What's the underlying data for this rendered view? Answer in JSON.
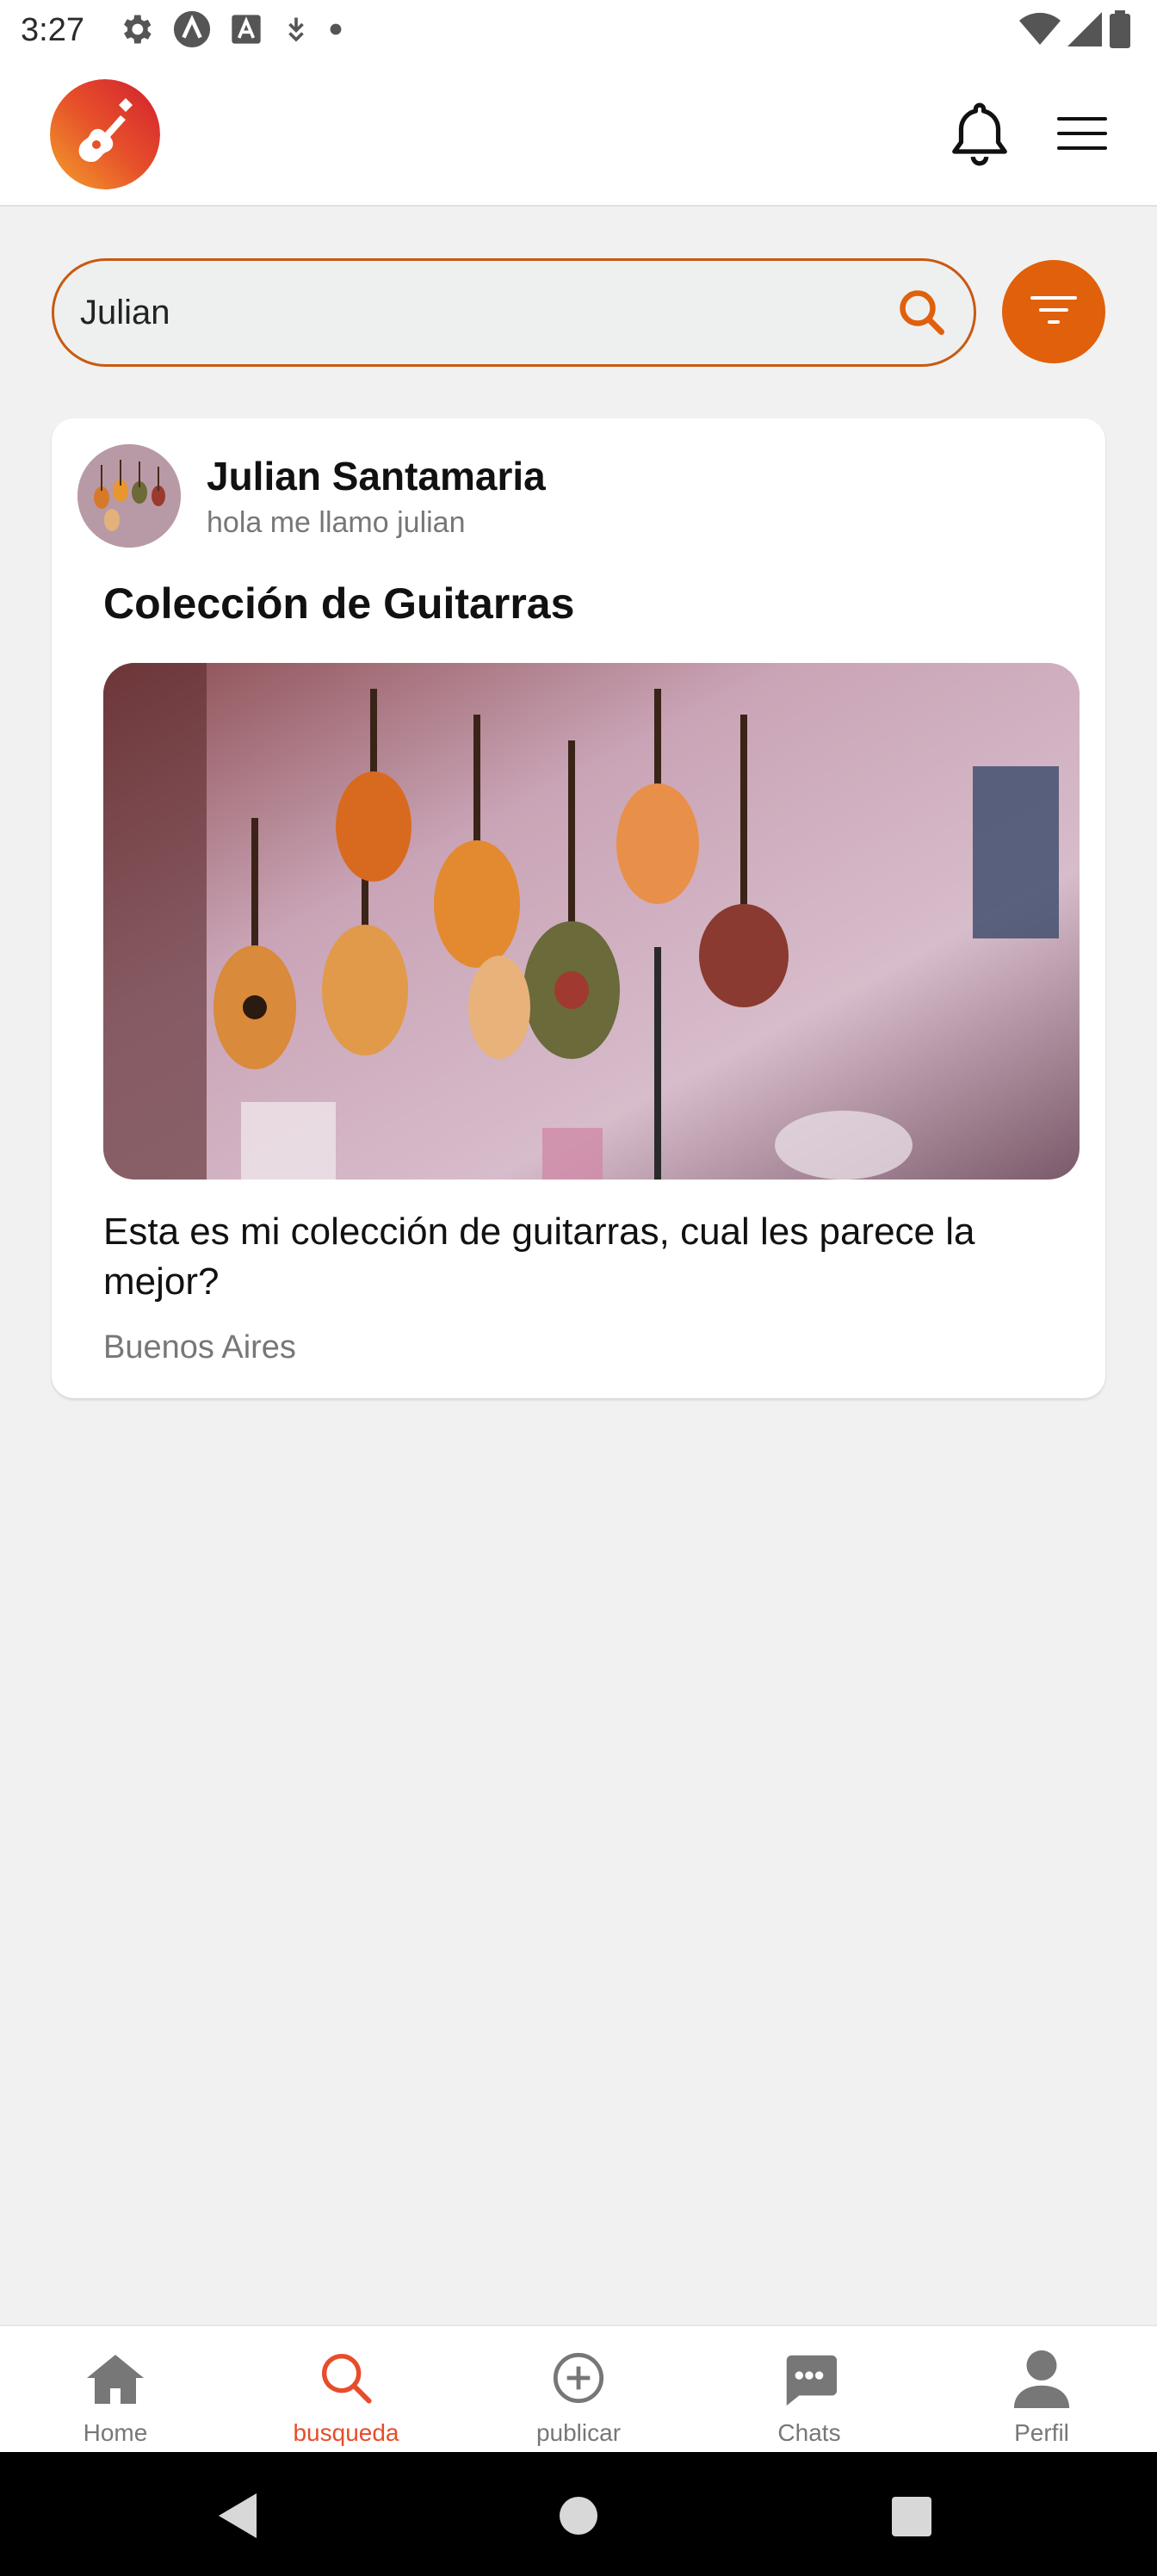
{
  "status_bar": {
    "time": "3:27",
    "left_icons": [
      "settings-icon",
      "a-circle-icon",
      "a-square-icon",
      "download-icon",
      "dot-icon"
    ],
    "right_icons": [
      "wifi-icon",
      "signal-icon",
      "battery-icon"
    ]
  },
  "header": {
    "logo_icon": "guitar-logo-icon",
    "notification_icon": "bell-icon",
    "menu_icon": "hamburger-menu-icon"
  },
  "search": {
    "value": "Julian",
    "icon": "search-icon",
    "filter_icon": "filter-icon"
  },
  "post": {
    "author_name": "Julian Santamaria",
    "author_bio": "hola me llamo julian",
    "title": "Colección de Guitarras",
    "image_alt": "guitars hanging on wall",
    "text": "Esta es mi colección de guitarras, cual les parece la mejor?",
    "location": "Buenos Aires"
  },
  "bottom_nav": {
    "items": [
      {
        "label": "Home",
        "icon": "home-icon",
        "active": false
      },
      {
        "label": "busqueda",
        "icon": "search-icon",
        "active": true
      },
      {
        "label": "publicar",
        "icon": "add-circle-icon",
        "active": false
      },
      {
        "label": "Chats",
        "icon": "chat-icon",
        "active": false
      },
      {
        "label": "Perfil",
        "icon": "person-icon",
        "active": false
      }
    ]
  },
  "colors": {
    "accent": "#e0600c",
    "active_nav": "#e84c2a",
    "search_border": "#c85a12"
  }
}
